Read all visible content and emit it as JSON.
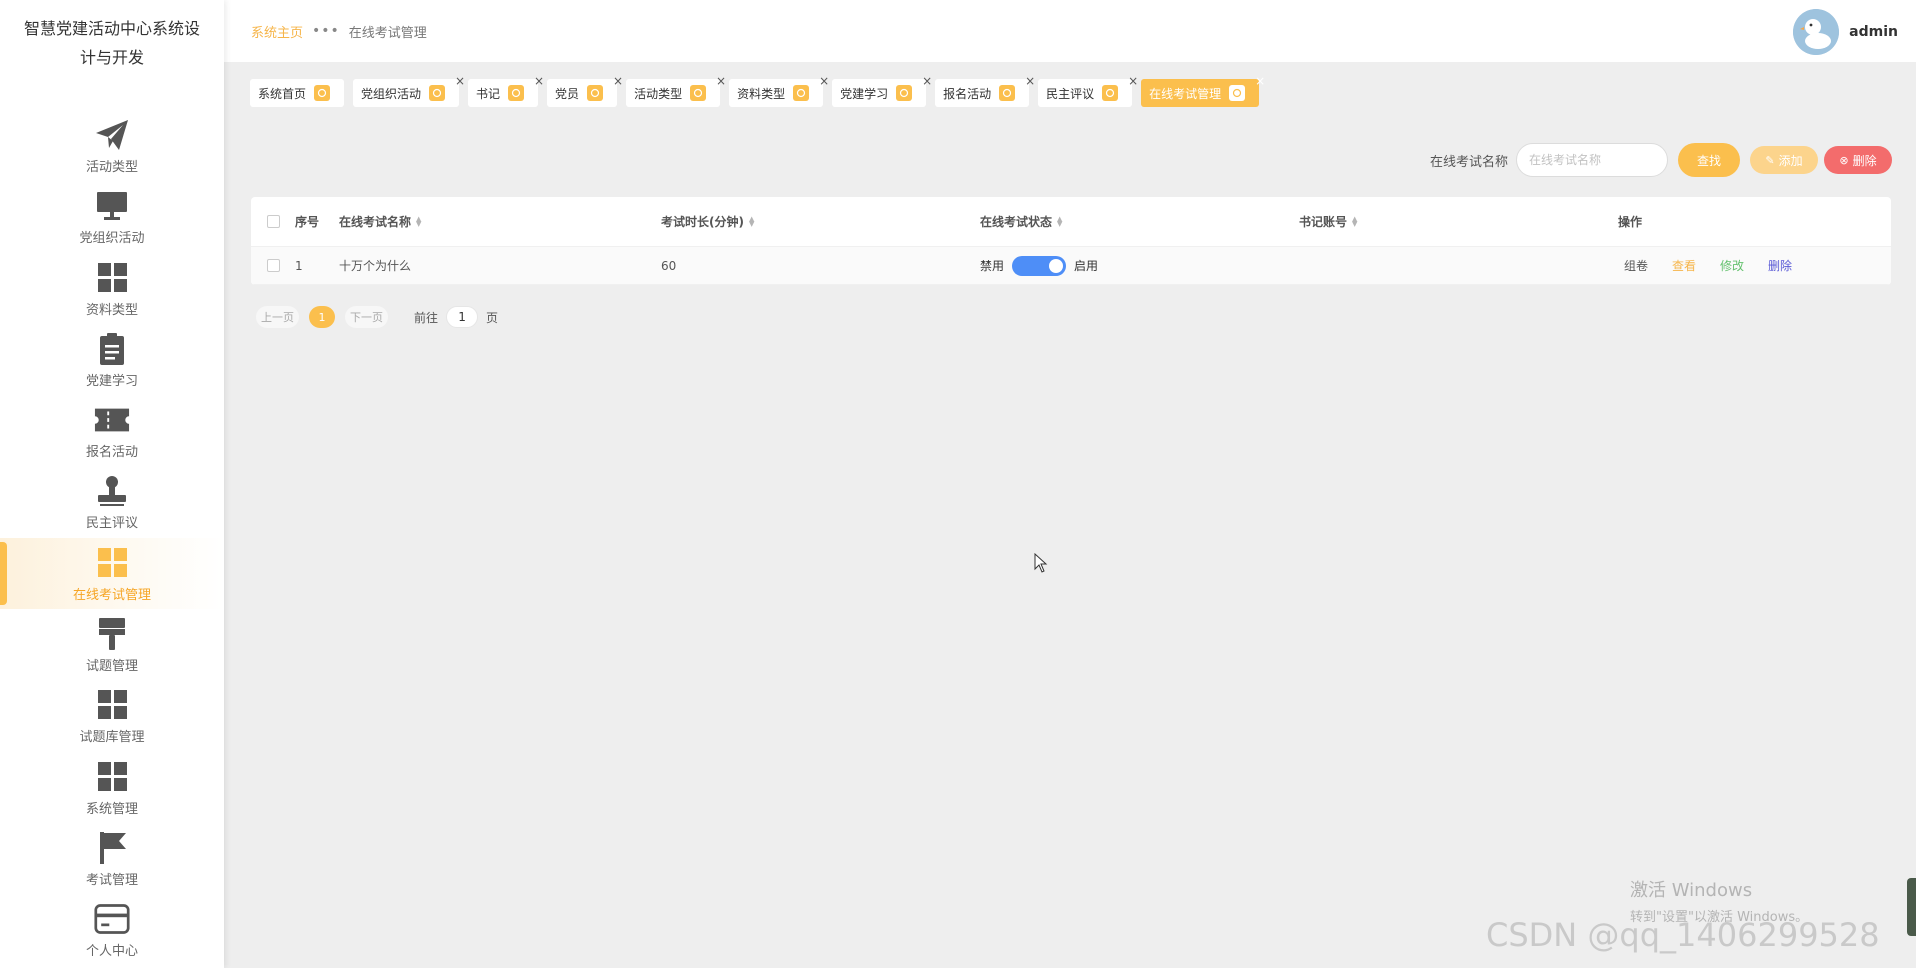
{
  "app": {
    "title": "智慧党建活动中心系统设计与开发",
    "title_line1": "智慧党建活动中心系统设",
    "title_line2": "计与开发"
  },
  "sidebar": {
    "items": [
      {
        "label": "活动类型",
        "icon": "paper-plane-icon"
      },
      {
        "label": "党组织活动",
        "icon": "monitor-icon"
      },
      {
        "label": "资料类型",
        "icon": "grid-icon"
      },
      {
        "label": "党建学习",
        "icon": "clipboard-icon"
      },
      {
        "label": "报名活动",
        "icon": "ticket-icon"
      },
      {
        "label": "民主评议",
        "icon": "stamp-icon"
      },
      {
        "label": "在线考试管理",
        "icon": "grid-icon",
        "active": true
      },
      {
        "label": "试题管理",
        "icon": "brush-icon"
      },
      {
        "label": "试题库管理",
        "icon": "grid-icon"
      },
      {
        "label": "系统管理",
        "icon": "grid-icon"
      },
      {
        "label": "考试管理",
        "icon": "flag-icon"
      },
      {
        "label": "个人中心",
        "icon": "card-icon"
      }
    ]
  },
  "header": {
    "breadcrumb_home": "系统主页",
    "breadcrumb_sep": "•••",
    "breadcrumb_current": "在线考试管理",
    "username": "admin"
  },
  "tabs": [
    {
      "label": "系统首页",
      "closable": false
    },
    {
      "label": "党组织活动",
      "closable": true
    },
    {
      "label": "书记",
      "closable": true
    },
    {
      "label": "党员",
      "closable": true
    },
    {
      "label": "活动类型",
      "closable": true
    },
    {
      "label": "资料类型",
      "closable": true
    },
    {
      "label": "党建学习",
      "closable": true
    },
    {
      "label": "报名活动",
      "closable": true
    },
    {
      "label": "民主评议",
      "closable": true
    },
    {
      "label": "在线考试管理",
      "closable": true,
      "active": true
    }
  ],
  "search": {
    "label": "在线考试名称",
    "placeholder": "在线考试名称",
    "search_btn": "查找",
    "add_btn": "添加",
    "delete_btn": "删除"
  },
  "table": {
    "columns": [
      "序号",
      "在线考试名称",
      "考试时长(分钟)",
      "在线考试状态",
      "书记账号",
      "操作"
    ],
    "rows": [
      {
        "index": "1",
        "name": "十万个为什么",
        "duration": "60",
        "status_off": "禁用",
        "status_on": "启用",
        "status_enabled": true,
        "account": ""
      }
    ],
    "actions": {
      "compose": "组卷",
      "view": "查看",
      "edit": "修改",
      "delete": "删除"
    }
  },
  "pagination": {
    "prev": "上一页",
    "current": "1",
    "next": "下一页",
    "goto_label": "前往",
    "goto_value": "1",
    "page_suffix": "页"
  },
  "watermarks": {
    "windows_line1": "激活 Windows",
    "windows_line2": "转到\"设置\"以激活 Windows。",
    "csdn": "CSDN @qq_1406299528"
  },
  "colors": {
    "accent": "#fbbf4d",
    "toggle": "#4e8ef7",
    "delete": "#f36c6c",
    "edit": "#64c16e",
    "delete_link": "#5a5ad6"
  }
}
